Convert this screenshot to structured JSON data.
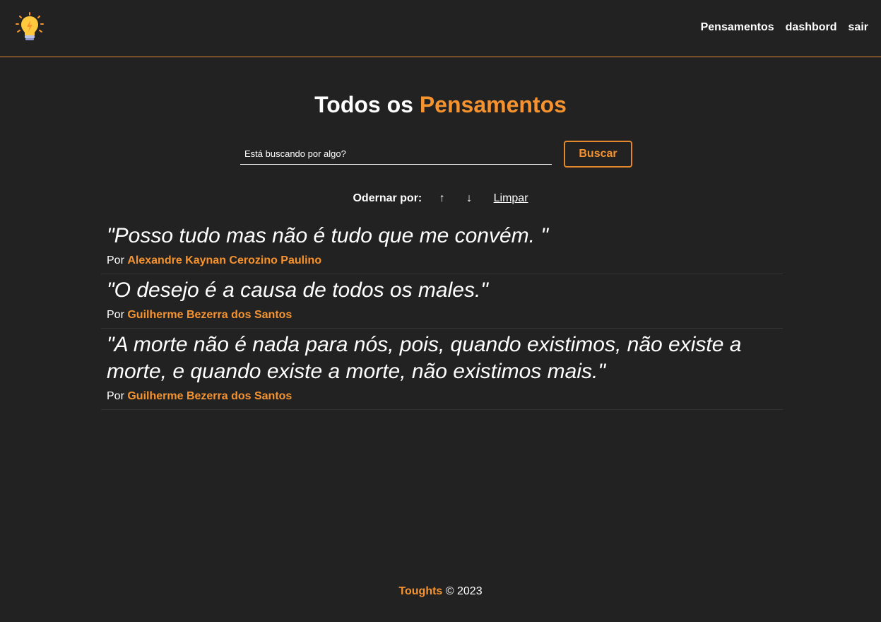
{
  "nav": {
    "logo_icon": "lightbulb-icon",
    "links": [
      "Pensamentos",
      "dashbord",
      "sair"
    ]
  },
  "page": {
    "title_prefix": "Todos os",
    "title_accent": "Pensamentos"
  },
  "search": {
    "placeholder": "Está buscando por algo?",
    "button_label": "Buscar"
  },
  "order": {
    "label": "Odernar por:",
    "asc_symbol": "↑",
    "desc_symbol": "↓",
    "clear_label": "Limpar"
  },
  "thoughts": [
    {
      "text": "\"Posso tudo mas não é tudo que me convém. \"",
      "by_label": "Por",
      "author": "Alexandre Kaynan Cerozino Paulino"
    },
    {
      "text": "\"O desejo é a causa de todos os males.\"",
      "by_label": "Por",
      "author": "Guilherme Bezerra dos Santos"
    },
    {
      "text": "\"A morte não é nada para nós, pois, quando existimos, não existe a morte, e quando existe a morte, não existimos mais.\"",
      "by_label": "Por",
      "author": "Guilherme Bezerra dos Santos"
    }
  ],
  "footer": {
    "brand": "Toughts",
    "copyright": "© 2023"
  },
  "colors": {
    "background": "#222222",
    "accent": "#f6932f",
    "border": "#e3892b"
  }
}
